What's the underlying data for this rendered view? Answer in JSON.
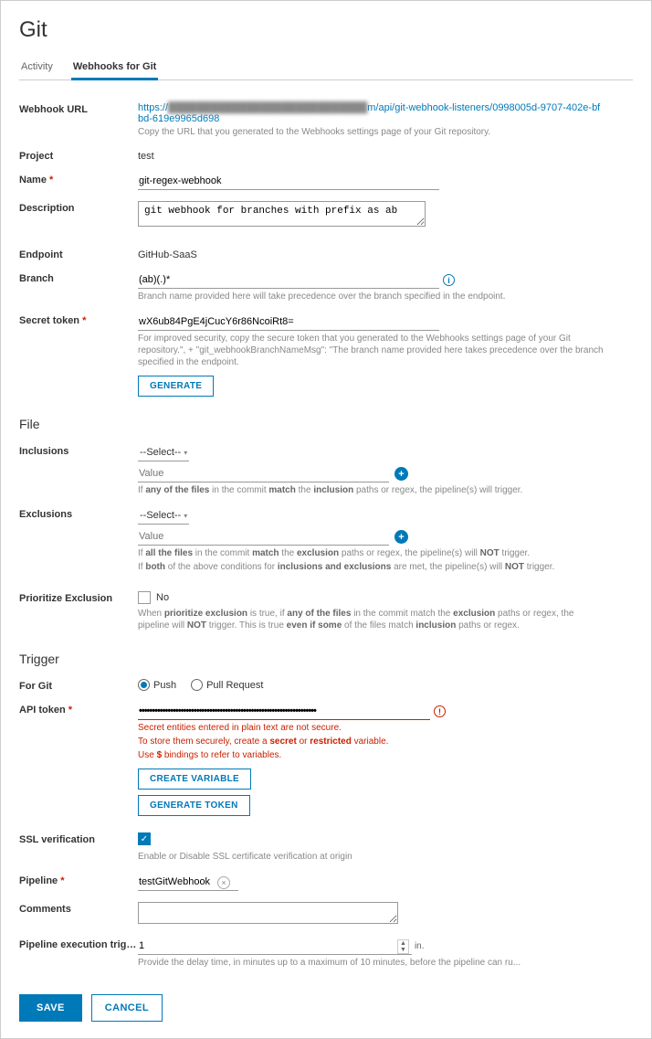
{
  "header": {
    "title": "Git"
  },
  "tabs": {
    "activity": "Activity",
    "webhooks": "Webhooks for Git"
  },
  "webhook_url": {
    "label": "Webhook URL",
    "prefix": "https://",
    "obscured": "████████████████████████████",
    "suffix": "m/api/git-webhook-listeners/0998005d-9707-402e-bfbd-619e9965d698",
    "hint": "Copy the URL that you generated to the Webhooks settings page of your Git repository."
  },
  "project": {
    "label": "Project",
    "value": "test"
  },
  "name": {
    "label": "Name",
    "value": "git-regex-webhook"
  },
  "description": {
    "label": "Description",
    "value": "git webhook for branches with prefix as ab"
  },
  "endpoint": {
    "label": "Endpoint",
    "value": "GitHub-SaaS"
  },
  "branch": {
    "label": "Branch",
    "value": "(ab)(.)*",
    "hint": "Branch name provided here will take precedence over the branch specified in the endpoint."
  },
  "secret": {
    "label": "Secret token",
    "value": "wX6ub84PgE4jCucY6r86NcoiRt8=",
    "hint": "For improved security, copy the secure token that you generated to the Webhooks settings page of your Git repository.\", + \"git_webhookBranchNameMsg\": \"The branch name provided here takes precedence over the branch specified in the endpoint.",
    "generate": "Generate"
  },
  "file_section": "File",
  "inclusions": {
    "label": "Inclusions",
    "select": "--Select--",
    "value_ph": "Value",
    "hint_a": "If ",
    "hint_b": "any of the files",
    "hint_c": " in the commit ",
    "hint_d": "match",
    "hint_e": " the ",
    "hint_f": "inclusion",
    "hint_g": " paths or regex, the pipeline(s) will trigger."
  },
  "exclusions": {
    "label": "Exclusions",
    "select": "--Select--",
    "value_ph": "Value",
    "hint1_a": "If ",
    "hint1_b": "all the files",
    "hint1_c": " in the commit ",
    "hint1_d": "match",
    "hint1_e": " the ",
    "hint1_f": "exclusion",
    "hint1_g": " paths or regex, the pipeline(s) will ",
    "hint1_h": "NOT",
    "hint1_i": " trigger.",
    "hint2_a": "If ",
    "hint2_b": "both",
    "hint2_c": " of the above conditions for ",
    "hint2_d": "inclusions and exclusions",
    "hint2_e": " are met, the pipeline(s) will ",
    "hint2_f": "NOT",
    "hint2_g": " trigger."
  },
  "prioritize": {
    "label": "Prioritize Exclusion",
    "no": "No",
    "hint_a": "When ",
    "hint_b": "prioritize exclusion",
    "hint_c": " is true, if ",
    "hint_d": "any of the files",
    "hint_e": " in the commit match the ",
    "hint_f": "exclusion",
    "hint_g": " paths or regex, the pipeline will ",
    "hint_h": "NOT",
    "hint_i": " trigger. This is true ",
    "hint_j": "even if some",
    "hint_k": " of the files match ",
    "hint_l": "inclusion",
    "hint_m": " paths or regex."
  },
  "trigger_section": "Trigger",
  "for_git": {
    "label": "For Git",
    "push": "Push",
    "pr": "Pull Request"
  },
  "api_token": {
    "label": "API token",
    "value": "••••••••••••••••••••••••••••••••••••••••••••••••••••••••••••••••••••",
    "err1": "Secret entities entered in plain text are not secure.",
    "err2a": "To store them securely, create a ",
    "err2b": "secret",
    "err2c": " or ",
    "err2d": "restricted",
    "err2e": " variable.",
    "err3a": "Use ",
    "err3b": "$",
    "err3c": " bindings to refer to variables.",
    "create_var": "Create Variable",
    "gen_token": "Generate Token"
  },
  "ssl": {
    "label": "SSL verification",
    "hint": "Enable or Disable SSL certificate verification at origin"
  },
  "pipeline": {
    "label": "Pipeline",
    "value": "testGitWebhook"
  },
  "comments": {
    "label": "Comments"
  },
  "delay": {
    "label": "Pipeline execution trigger d...",
    "value": "1",
    "unit": "in.",
    "hint": "Provide the delay time, in minutes up to a maximum of 10 minutes, before the pipeline can ru..."
  },
  "actions": {
    "save": "SAVE",
    "cancel": "CANCEL"
  }
}
